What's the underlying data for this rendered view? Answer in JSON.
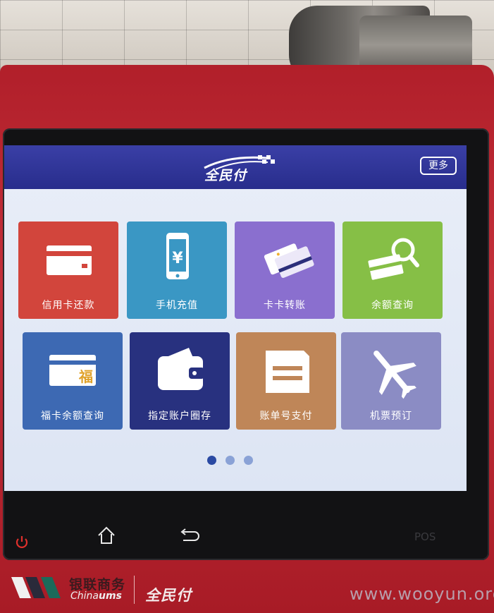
{
  "app": {
    "title": "全民付",
    "more_label": "更多"
  },
  "tiles": [
    {
      "label": "信用卡还款",
      "icon": "credit-card-icon",
      "color": "#d2453c"
    },
    {
      "label": "手机充值",
      "icon": "mobile-phone-yuan-icon",
      "color": "#3a97c4"
    },
    {
      "label": "卡卡转账",
      "icon": "card-transfer-icon",
      "color": "#8a6fcf"
    },
    {
      "label": "余额查询",
      "icon": "card-search-icon",
      "color": "#86bf46"
    },
    {
      "label": "福卡余额查询",
      "icon": "fu-card-icon",
      "color": "#3d69b3"
    },
    {
      "label": "指定账户圈存",
      "icon": "wallet-icon",
      "color": "#28317f"
    },
    {
      "label": "账单号支付",
      "icon": "bill-icon",
      "color": "#bf8658"
    },
    {
      "label": "机票预订",
      "icon": "airplane-icon",
      "color": "#8b8cc4"
    }
  ],
  "fu_char": "福",
  "pagination": {
    "pages": 3,
    "current": 1,
    "active_color": "#2a4aa3",
    "inactive_color": "#8aa2d6"
  },
  "device": {
    "pos_label": "POS",
    "brand_cn": "银联商务",
    "brand_en_prefix": "China",
    "brand_en_suffix": "ums",
    "brand2": "全民付"
  },
  "watermark": "www.wooyun.org"
}
